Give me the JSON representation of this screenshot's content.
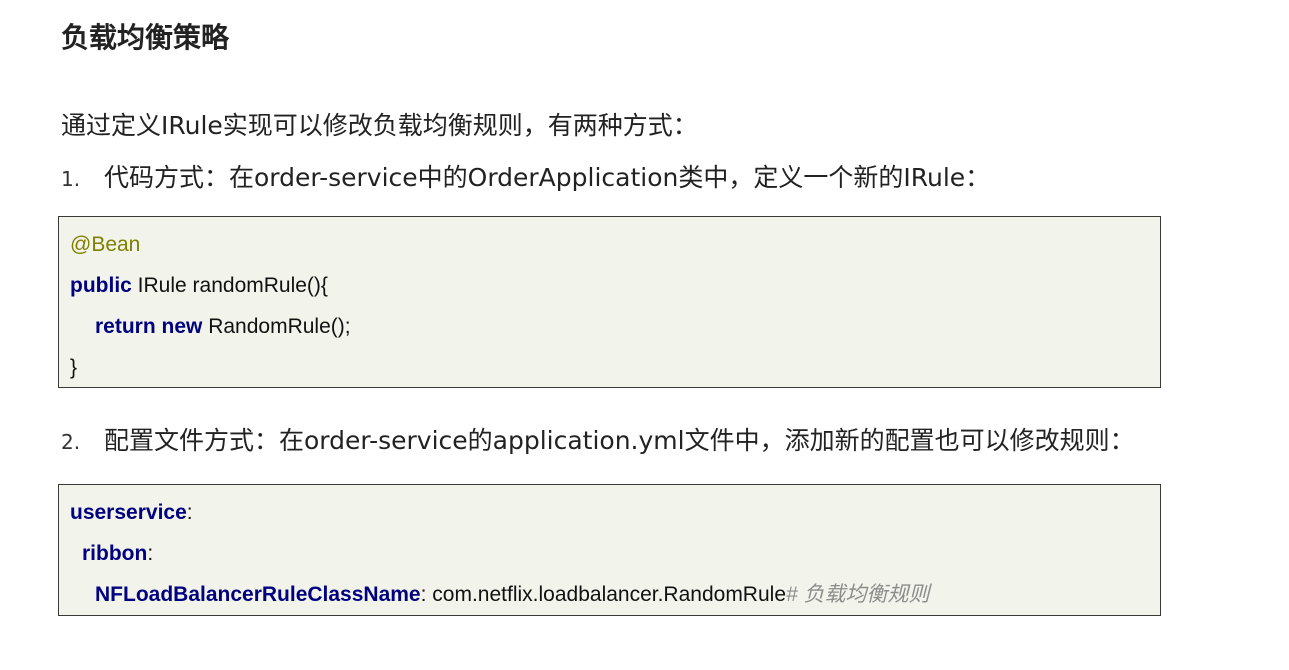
{
  "heading": "负载均衡策略",
  "intro": "通过定义IRule实现可以修改负载均衡规则，有两种方式：",
  "steps": [
    {
      "num": "1.",
      "text": "代码方式：在order-service中的OrderApplication类中，定义一个新的IRule："
    },
    {
      "num": "2.",
      "text": "配置文件方式：在order-service的application.yml文件中，添加新的配置也可以修改规则："
    }
  ],
  "code1": {
    "annotation": "@Bean",
    "line2_kw": "public",
    "line2_rest": " IRule randomRule(){",
    "line3_kw": "return new",
    "line3_rest": " RandomRule();",
    "line4": "}"
  },
  "code2": {
    "key1": "userservice",
    "key2": "ribbon",
    "key3": "NFLoadBalancerRuleClassName",
    "colon": ":",
    "value3": " com.netflix.loadbalancer.RandomRule",
    "comment": "# 负载均衡规则"
  }
}
